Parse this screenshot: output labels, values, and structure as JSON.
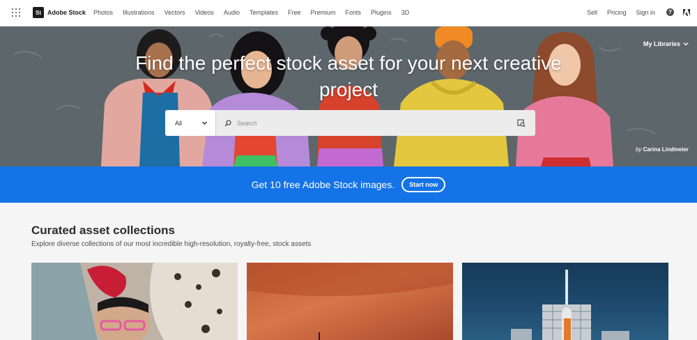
{
  "nav": {
    "brand_badge": "St",
    "brand": "Adobe Stock",
    "links": [
      "Photos",
      "Illustrations",
      "Vectors",
      "Videos",
      "Audio",
      "Templates",
      "Free",
      "Premium",
      "Fonts",
      "Plugins",
      "3D"
    ],
    "right": [
      "Sell",
      "Pricing",
      "Sign in"
    ],
    "help": "?"
  },
  "hero": {
    "title": "Find the perfect stock asset for your next creative project",
    "libraries": "My Libraries",
    "credit_by": "by",
    "credit_name": "Carina Lindmeier",
    "search": {
      "category": "All",
      "placeholder": "Search"
    }
  },
  "promo": {
    "text": "Get 10 free Adobe Stock images.",
    "cta": "Start now",
    "color": "#1473e6"
  },
  "section": {
    "title": "Curated asset collections",
    "subtitle": "Explore diverse collections of our most incredible high-resolution, royalty-free, stock assets"
  }
}
